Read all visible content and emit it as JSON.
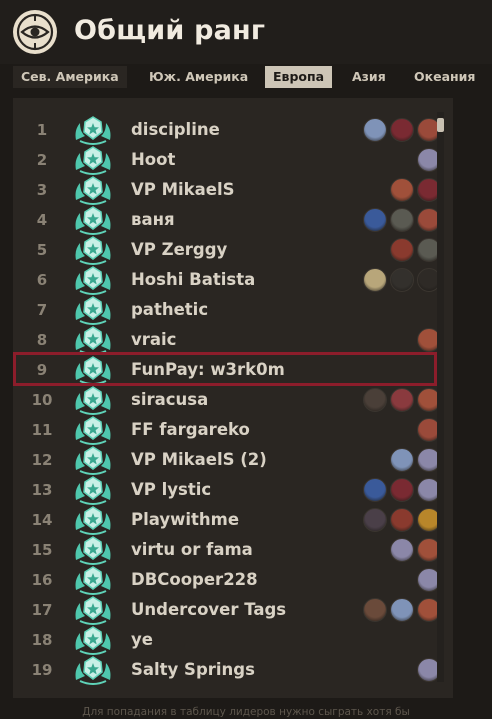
{
  "header": {
    "title": "Общий ранг",
    "logo_icon": "eye-emblem-icon"
  },
  "region_tabs": [
    {
      "label": "Сев. Америка",
      "active": false
    },
    {
      "label": "Юж. Америка",
      "active": false
    },
    {
      "label": "Европа",
      "active": true
    },
    {
      "label": "Азия",
      "active": false
    },
    {
      "label": "Океания",
      "active": false
    }
  ],
  "leaderboard": {
    "highlighted_rank": "9",
    "rows": [
      {
        "rank": "1",
        "name": "discipline",
        "heroes": [
          "#7f93b8",
          "#7a2a32",
          "#9a4a3a"
        ]
      },
      {
        "rank": "2",
        "name": "Hoot",
        "heroes": [
          "#8b87a8"
        ]
      },
      {
        "rank": "3",
        "name": "VP MikaelS",
        "heroes": [
          "#a0503a",
          "#7a2a32"
        ]
      },
      {
        "rank": "4",
        "name": "ваня",
        "heroes": [
          "#3a5a9a",
          "#5a5a52",
          "#9a4a3a"
        ]
      },
      {
        "rank": "5",
        "name": "VP Zerggy",
        "heroes": [
          "#8a3a2e",
          "#5a5a52"
        ]
      },
      {
        "rank": "6",
        "name": "Hoshi Batista",
        "heroes": [
          "#b8a67a",
          "#33302c",
          "#2e2a26"
        ]
      },
      {
        "rank": "7",
        "name": "pathetic",
        "heroes": []
      },
      {
        "rank": "8",
        "name": "vraic",
        "heroes": [
          "#a0503a"
        ]
      },
      {
        "rank": "9",
        "name": "FunPay: w3rk0m",
        "heroes": []
      },
      {
        "rank": "10",
        "name": "siracusa",
        "heroes": [
          "#4a3f38",
          "#8a3a3e",
          "#a0503a"
        ]
      },
      {
        "rank": "11",
        "name": "FF fargareko",
        "heroes": [
          "#9a4a3a"
        ]
      },
      {
        "rank": "12",
        "name": "VP MikaelS (2)",
        "heroes": [
          "#7f93b8",
          "#8b87a8"
        ]
      },
      {
        "rank": "13",
        "name": "VP lystic",
        "heroes": [
          "#3a5a9a",
          "#7a2a32",
          "#8b87a8"
        ]
      },
      {
        "rank": "14",
        "name": "Playwithme",
        "heroes": [
          "#4a3f48",
          "#8a3a2e",
          "#b8862a"
        ]
      },
      {
        "rank": "15",
        "name": "virtu or fama",
        "heroes": [
          "#8b87a8",
          "#a0503a"
        ]
      },
      {
        "rank": "16",
        "name": "DBCooper228",
        "heroes": [
          "#8b87a8"
        ]
      },
      {
        "rank": "17",
        "name": "Undercover Tags",
        "heroes": [
          "#6a4a3a",
          "#7f93b8",
          "#a0503a"
        ]
      },
      {
        "rank": "18",
        "name": "ye",
        "heroes": []
      },
      {
        "rank": "19",
        "name": "Salty Springs",
        "heroes": [
          "#8b87a8"
        ]
      }
    ]
  },
  "footer": {
    "text": "Для попадания в таблицу лидеров нужно сыграть хотя бы"
  }
}
